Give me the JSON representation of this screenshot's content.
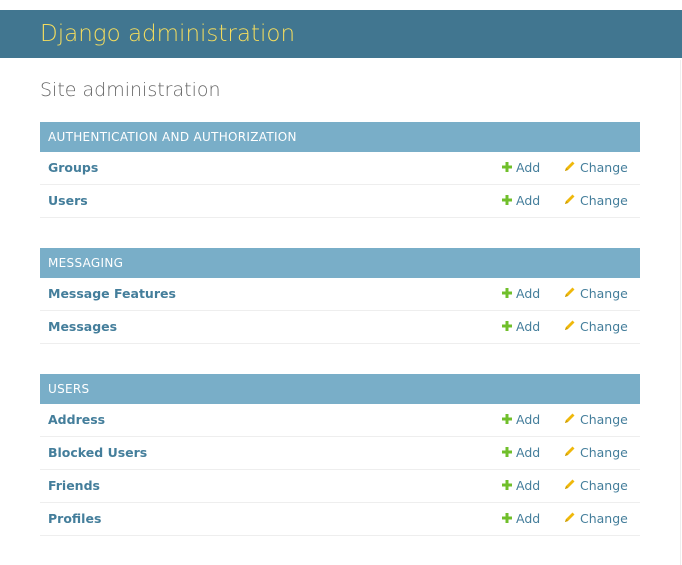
{
  "header": {
    "site_name": "Django administration"
  },
  "page": {
    "title": "Site administration"
  },
  "colors": {
    "header_bg": "#417690",
    "site_name": "#f5dd5d",
    "caption_bg": "#79aec8",
    "link": "#447e9b",
    "add_icon": "#70bf2b",
    "change_icon": "#efb80b"
  },
  "actions": {
    "add_label": "Add",
    "change_label": "Change",
    "add_icon": "plus-icon",
    "change_icon": "pencil-icon"
  },
  "apps": [
    {
      "caption": "AUTHENTICATION AND AUTHORIZATION",
      "models": [
        {
          "name": "Groups"
        },
        {
          "name": "Users"
        }
      ]
    },
    {
      "caption": "MESSAGING",
      "models": [
        {
          "name": "Message Features"
        },
        {
          "name": "Messages"
        }
      ]
    },
    {
      "caption": "USERS",
      "models": [
        {
          "name": "Address"
        },
        {
          "name": "Blocked Users"
        },
        {
          "name": "Friends"
        },
        {
          "name": "Profiles"
        }
      ]
    }
  ]
}
